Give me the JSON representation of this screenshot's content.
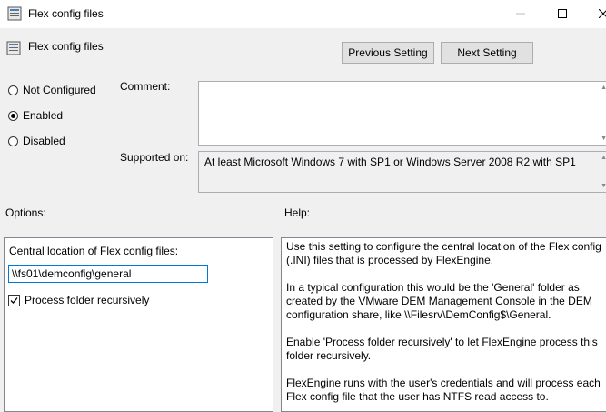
{
  "window": {
    "title": "Flex config files",
    "icons": {
      "app": "policy-setting-icon",
      "minimize": "minimize-icon",
      "maximize": "maximize-icon",
      "close": "close-icon"
    }
  },
  "header": {
    "setting_title": "Flex config files",
    "prev_button": "Previous Setting",
    "next_button": "Next Setting"
  },
  "state": {
    "not_configured": "Not Configured",
    "enabled": "Enabled",
    "disabled": "Disabled",
    "selected": "enabled"
  },
  "fields": {
    "comment_label": "Comment:",
    "comment_value": "",
    "supported_label": "Supported on:",
    "supported_value": "At least Microsoft Windows 7 with SP1 or Windows Server 2008 R2 with SP1"
  },
  "options": {
    "heading": "Options:",
    "location_label": "Central location of Flex config files:",
    "location_value": "\\\\fs01\\demconfig\\general",
    "recursive_label": "Process folder recursively",
    "recursive_checked": true
  },
  "help": {
    "heading": "Help:",
    "paragraphs": [
      "Use this setting to configure the central location of the Flex config (.INI) files that is processed by FlexEngine.",
      "In a typical configuration this would be the 'General' folder as created by the VMware DEM Management Console in the DEM configuration share, like \\\\Filesrv\\DemConfig$\\General.",
      "Enable 'Process folder recursively' to let FlexEngine process this folder recursively.",
      "FlexEngine runs with the user's credentials and will process each Flex config file that the user has NTFS read access to."
    ]
  }
}
